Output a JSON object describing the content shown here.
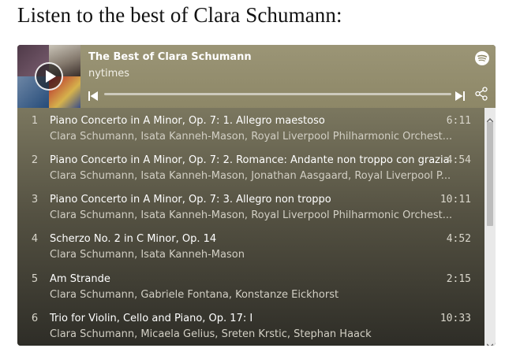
{
  "page": {
    "heading": "Listen to the best of Clara Schumann:"
  },
  "player": {
    "playlist_title": "The Best of Clara Schumann",
    "owner": "nytimes",
    "icons": {
      "logo": "spotify-logo-icon",
      "play": "play-icon",
      "previous": "skip-previous-icon",
      "next": "skip-next-icon",
      "share": "share-icon"
    },
    "tracks": [
      {
        "number": "1",
        "title": "Piano Concerto in A Minor, Op. 7: 1. Allegro maestoso",
        "artists": "Clara Schumann, Isata Kanneh-Mason, Royal Liverpool Philharmonic Orchest...",
        "duration": "6:11"
      },
      {
        "number": "2",
        "title": "Piano Concerto in A Minor, Op. 7: 2. Romance: Andante non troppo con grazia",
        "artists": "Clara Schumann, Isata Kanneh-Mason, Jonathan Aasgaard, Royal Liverpool P...",
        "duration": "4:54"
      },
      {
        "number": "3",
        "title": "Piano Concerto in A Minor, Op. 7: 3. Allegro non troppo",
        "artists": "Clara Schumann, Isata Kanneh-Mason, Royal Liverpool Philharmonic Orchest...",
        "duration": "10:11"
      },
      {
        "number": "4",
        "title": "Scherzo No. 2 in C Minor, Op. 14",
        "artists": "Clara Schumann, Isata Kanneh-Mason",
        "duration": "4:52"
      },
      {
        "number": "5",
        "title": "Am Strande",
        "artists": "Clara Schumann, Gabriele Fontana, Konstanze Eickhorst",
        "duration": "2:15"
      },
      {
        "number": "6",
        "title": "Trio for Violin, Cello and Piano, Op. 17: I",
        "artists": "Clara Schumann, Micaela Gelius, Sreten Krstic, Stephan Haack",
        "duration": "10:33"
      }
    ]
  },
  "colors": {
    "header_bg": "#9b9576",
    "list_bg_top": "#7b775f",
    "list_bg_bottom": "#2e2d27"
  }
}
